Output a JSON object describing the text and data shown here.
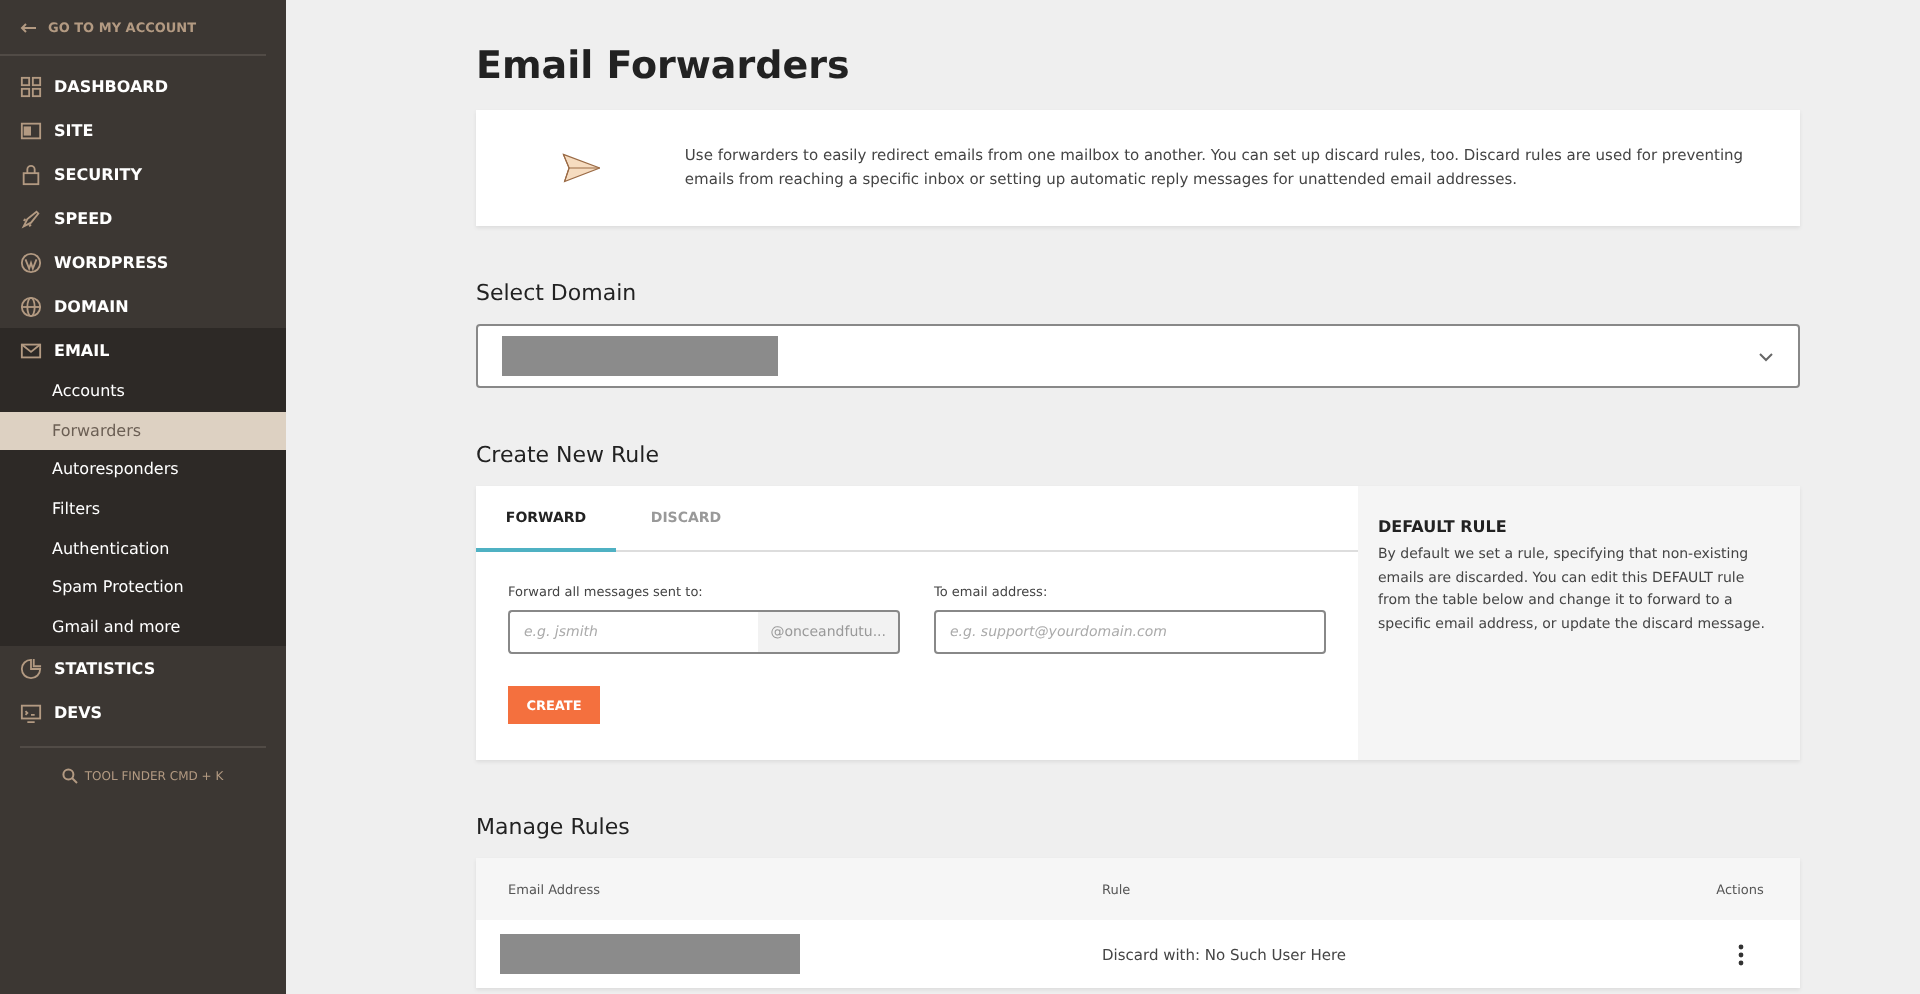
{
  "sidebar": {
    "back_link": "GO TO MY ACCOUNT",
    "items": [
      {
        "label": "DASHBOARD",
        "expanded": false
      },
      {
        "label": "SITE",
        "expanded": false
      },
      {
        "label": "SECURITY",
        "expanded": false
      },
      {
        "label": "SPEED",
        "expanded": false
      },
      {
        "label": "WORDPRESS",
        "expanded": false
      },
      {
        "label": "DOMAIN",
        "expanded": false
      },
      {
        "label": "EMAIL",
        "expanded": true,
        "children": [
          {
            "label": "Accounts",
            "selected": false
          },
          {
            "label": "Forwarders",
            "selected": true
          },
          {
            "label": "Autoresponders",
            "selected": false
          },
          {
            "label": "Filters",
            "selected": false
          },
          {
            "label": "Authentication",
            "selected": false
          },
          {
            "label": "Spam Protection",
            "selected": false
          },
          {
            "label": "Gmail and more",
            "selected": false
          }
        ]
      },
      {
        "label": "STATISTICS",
        "expanded": false
      },
      {
        "label": "DEVS",
        "expanded": false
      }
    ],
    "tool_finder": "TOOL FINDER CMD + K"
  },
  "page_title": "Email Forwarders",
  "intro": "Use forwarders to easily redirect emails from one mailbox to another. You can set up discard rules, too. Discard rules are used for preventing emails from reaching a specific inbox or setting up automatic reply messages for unattended email addresses.",
  "select_domain": {
    "heading": "Select Domain"
  },
  "create_rule": {
    "heading": "Create New Rule",
    "tabs": [
      {
        "label": "FORWARD",
        "selected": true
      },
      {
        "label": "DISCARD",
        "selected": false
      }
    ],
    "from_field": {
      "label": "Forward all messages sent to:",
      "placeholder": "e.g. jsmith",
      "suffix": "@onceandfutu..."
    },
    "to_field": {
      "label": "To email address:",
      "placeholder": "e.g. support@yourdomain.com"
    },
    "button": "CREATE",
    "default_rule": {
      "title": "DEFAULT RULE",
      "text": "By default we set a rule, specifying that non-existing emails are discarded. You can edit this DEFAULT rule from the table below and change it to forward to a specific email address, or update the discard message."
    }
  },
  "manage_rules": {
    "heading": "Manage Rules",
    "columns": [
      "Email Address",
      "Rule",
      "Actions"
    ],
    "rows": [
      {
        "rule": "Discard with: No Such User Here"
      }
    ]
  }
}
